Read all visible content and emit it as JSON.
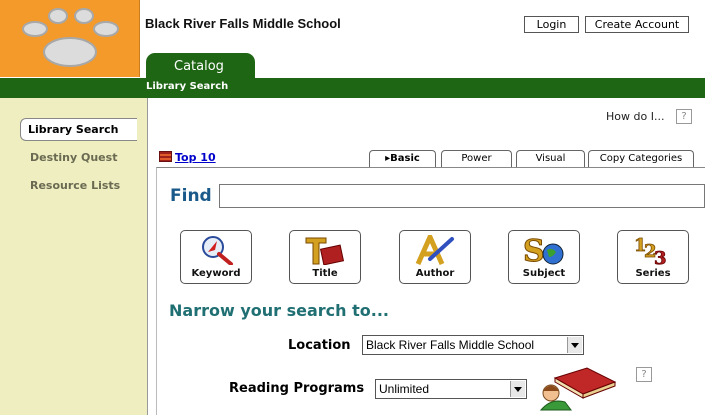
{
  "header": {
    "school_name": "Black River Falls Middle School",
    "login_label": "Login",
    "create_account_label": "Create Account",
    "catalog_tab": "Catalog",
    "sub_label": "Library Search"
  },
  "sidebar": {
    "items": [
      {
        "label": "Library Search",
        "active": true
      },
      {
        "label": "Destiny Quest",
        "active": false
      },
      {
        "label": "Resource Lists",
        "active": false
      }
    ]
  },
  "help": {
    "how_do_i": "How do I...",
    "icon_glyph": "?"
  },
  "top10": "Top 10",
  "search_tabs": [
    {
      "label": "▸Basic",
      "active": true
    },
    {
      "label": "Power",
      "active": false
    },
    {
      "label": "Visual",
      "active": false
    },
    {
      "label": "Copy Categories",
      "active": false
    }
  ],
  "find": {
    "label": "Find",
    "value": ""
  },
  "search_buttons": [
    {
      "label": "Keyword",
      "icon": "magnifier-compass-icon"
    },
    {
      "label": "Title",
      "icon": "title-book-icon"
    },
    {
      "label": "Author",
      "icon": "author-pen-icon"
    },
    {
      "label": "Subject",
      "icon": "subject-globe-icon"
    },
    {
      "label": "Series",
      "icon": "series-numbers-icon"
    }
  ],
  "narrow": {
    "heading": "Narrow your search to...",
    "location_label": "Location",
    "location_value": "Black River Falls Middle School",
    "reading_label": "Reading Programs",
    "reading_value": "Unlimited"
  },
  "colors": {
    "brand_green": "#1e6614",
    "logo_orange": "#f39a2a",
    "sidebar_bg": "#efeec0",
    "find_blue": "#1a5a8a",
    "narrow_teal": "#1f6f73"
  }
}
